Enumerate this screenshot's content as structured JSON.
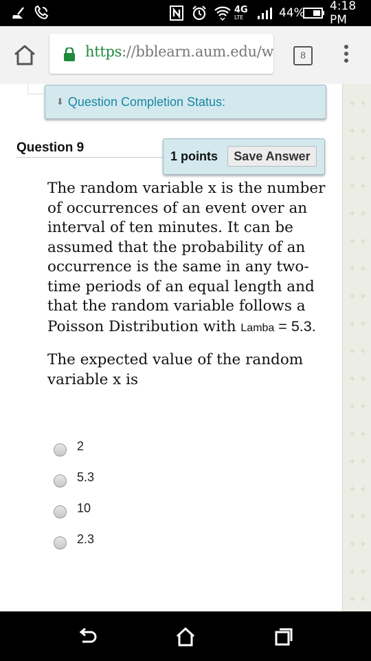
{
  "status_bar": {
    "network": "4G",
    "network_sub": "LTE",
    "battery": "44%",
    "time": "4:18 PM"
  },
  "browser": {
    "url_scheme": "https",
    "url_rest": "://bblearn.aum.edu/webap",
    "tab_count": "8"
  },
  "page": {
    "completion_status": "Question Completion Status:",
    "question_title": "Question 9",
    "points": "1 points",
    "save_answer": "Save Answer",
    "question_text_main": "The random variable x is the number of occurrences of an event over an interval of ten minutes. It can be assumed that the probability of an occurrence is the same in any two-time periods of an equal length and that the random variable follows a Poisson Distribution with ",
    "lambda_label": "Lamba",
    "lambda_eq": " = 5.3.",
    "question_text_2": "The expected value of the random variable x is",
    "options": [
      {
        "label": "2"
      },
      {
        "label": "5.3"
      },
      {
        "label": "10"
      },
      {
        "label": "2.3"
      }
    ]
  },
  "colors": {
    "panel_bg": "#d3e9ee",
    "link_teal": "#1a86a3",
    "url_green": "#1e8a3c"
  }
}
